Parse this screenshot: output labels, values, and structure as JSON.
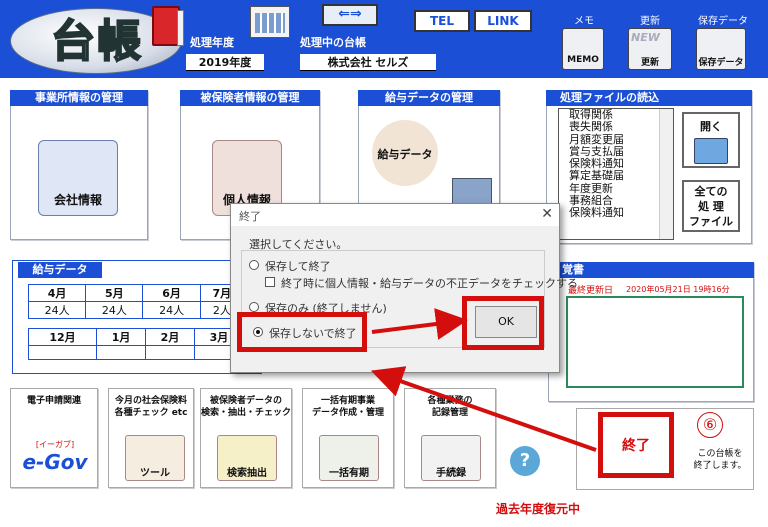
{
  "app": {
    "logo_text": "台帳"
  },
  "header": {
    "year_label": "処理年度",
    "year_value": "2019年度",
    "company_label": "処理中の台帳",
    "company_value": "株式会社 セルズ",
    "switch_icon_text": "⇐⇒",
    "tel_label": "TEL",
    "link_label": "LINK",
    "memo_label": "メモ",
    "memo_icon_text": "MEMO",
    "update_label": "更新",
    "update_icon_text": "更新",
    "update_badge": "NEW",
    "save_label": "保存データ",
    "save_icon_text": "保存データ"
  },
  "panels": {
    "office": {
      "title": "事業所情報の管理",
      "icon_label": "会社情報"
    },
    "insured": {
      "title": "被保険者情報の管理",
      "icon_label": "個人情報"
    },
    "salary": {
      "title": "給与データの管理",
      "icon_label": "給与データ"
    },
    "files": {
      "title": "処理ファイルの読込",
      "items": [
        "取得関係",
        "喪失関係",
        "月額変更届",
        "賞与支払届",
        "保険料通知",
        "算定基礎届",
        "年度更新",
        "事務組合",
        "保険料通知"
      ],
      "open_label": "開く",
      "all_files_line1": "全ての",
      "all_files_line2": "処 理",
      "all_files_line3": "ファイル"
    }
  },
  "salary_data": {
    "title": "給与データ",
    "months_top": [
      "4月",
      "5月",
      "6月",
      "7月"
    ],
    "counts_top": [
      "24人",
      "24人",
      "24人",
      "2人"
    ],
    "months_bottom": [
      "12月",
      "1月",
      "2月",
      "3月"
    ]
  },
  "memo": {
    "title": "覚書",
    "last_update_label": "最終更新日",
    "last_update_value": "2020年05月21日 19時16分"
  },
  "tiles": [
    {
      "title": "電子申請関連",
      "icon_label": "e-Gov",
      "icon_sub": "[イーガブ]"
    },
    {
      "title": "今月の社会保険料\n各種チェック etc",
      "icon_label": "ツール"
    },
    {
      "title": "被保険者データの\n検索・抽出・チェック",
      "icon_label": "検索抽出"
    },
    {
      "title": "一括有期事業\nデータ作成・管理",
      "icon_label": "一括有期"
    },
    {
      "title": "各種業務の\n記録管理",
      "icon_label": "手続録"
    }
  ],
  "help_icon_text": "?",
  "end_button": {
    "label": "終了",
    "step_number": "⑥",
    "hint_line1": "この台帳を",
    "hint_line2": "終了します。"
  },
  "status_text": "過去年度復元中",
  "dialog": {
    "title": "終了",
    "close_icon": "✕",
    "prompt": "選択してください。",
    "option_save_exit": "保存して終了",
    "check_label": "終了時に個人情報・給与データの不正データをチェックする",
    "option_save_only": "保存のみ (終了しません)",
    "option_no_save": "保存しないで終了",
    "ok_label": "OK"
  },
  "colors": {
    "header_blue": "#1a4fd6",
    "highlight_red": "#d40d0d",
    "memo_green": "#2a8a5a"
  }
}
